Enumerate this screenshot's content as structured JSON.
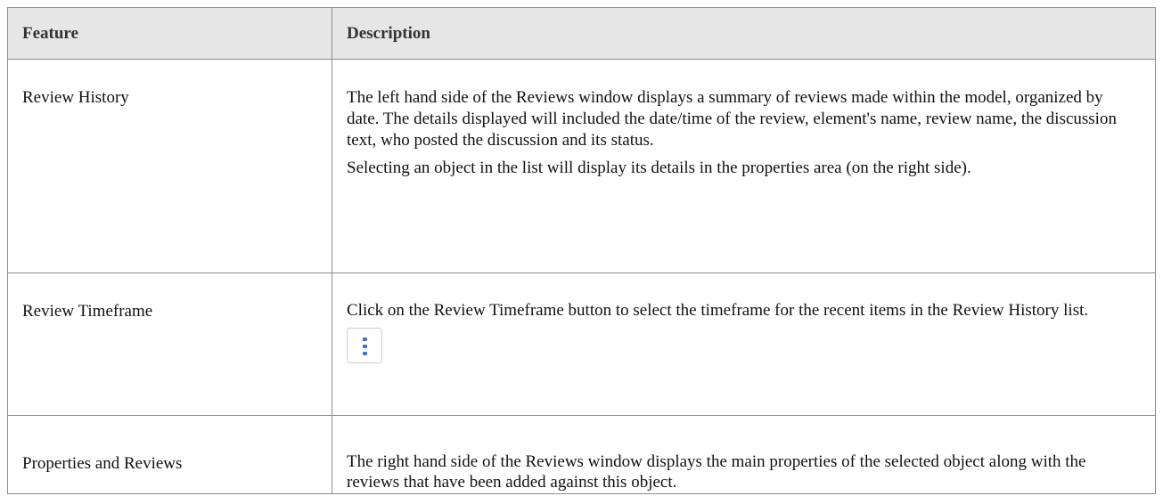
{
  "table": {
    "headers": [
      "Feature",
      "Description"
    ],
    "rows": [
      {
        "feature": "Review History",
        "paragraphs": [
          "The left hand side of the Reviews window displays a summary of reviews made within the model, organized by date. The details displayed will included the date/time of the review, element's name, review name, the discussion text, who posted the discussion and its status.",
          "Selecting an object in the list will display its details in the properties area (on the right side)."
        ]
      },
      {
        "feature": "Review Timeframe",
        "paragraphs": [
          "Click on the Review Timeframe button to select the timeframe for the recent items in the Review History list."
        ],
        "button_icon": "vertical-ellipsis-icon",
        "button_icon_color": "#3a78c2"
      },
      {
        "feature": "Properties and Reviews",
        "paragraphs": [
          "The right hand side of the Reviews window displays the main properties of the selected object along with the reviews that have been added against this object."
        ]
      }
    ]
  }
}
